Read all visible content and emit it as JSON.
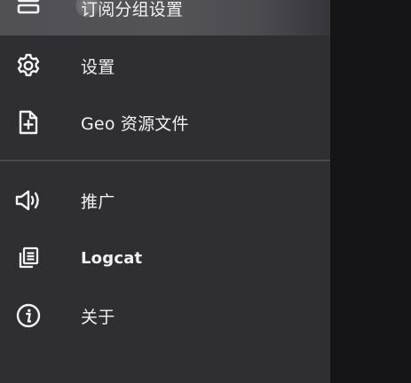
{
  "drawer": {
    "items": [
      {
        "label": "订阅分组设置",
        "icon": "subscription-group-icon",
        "selected": true
      },
      {
        "label": "设置",
        "icon": "gear-icon"
      },
      {
        "label": "Geo 资源文件",
        "icon": "add-file-icon"
      },
      {
        "label": "推广",
        "icon": "speaker-icon"
      },
      {
        "label": "Logcat",
        "icon": "logcat-icon"
      },
      {
        "label": "关于",
        "icon": "info-icon"
      }
    ]
  },
  "colors": {
    "drawer_bg": "#2f2e33",
    "scrim": "#151417",
    "text": "#f2f1f4",
    "divider": "#4a494e"
  }
}
